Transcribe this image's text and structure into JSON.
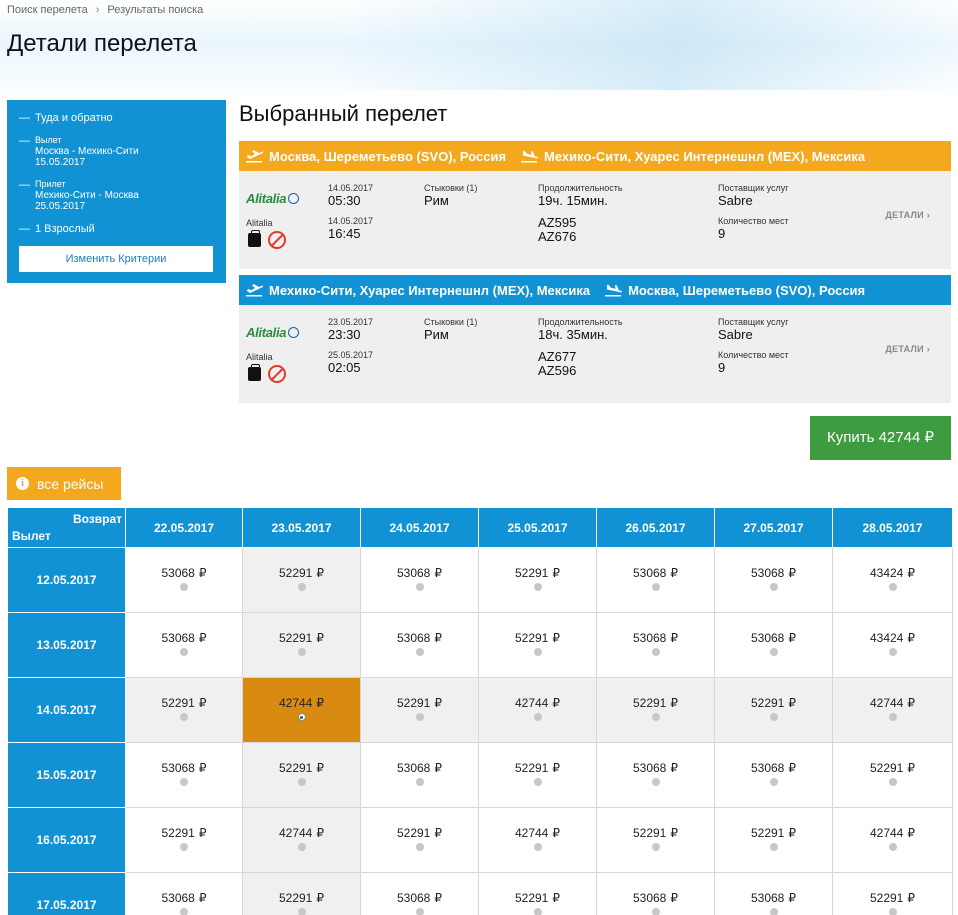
{
  "breadcrumb": {
    "item1": "Поиск перелета",
    "sep": "›",
    "item2": "Результаты поиска"
  },
  "page_title": "Детали перелета",
  "sidebar": {
    "trip_type": "Туда и обратно",
    "depart_label": "Вылет",
    "depart_route": "Москва - Мехико-Сити",
    "depart_date": "15.05.2017",
    "arrive_label": "Прилет",
    "arrive_route": "Мехико-Сити - Москва",
    "arrive_date": "25.05.2017",
    "passengers": "1 Взрослый",
    "change_button": "Изменить Критерии"
  },
  "selected_title": "Выбранный перелет",
  "flights": [
    {
      "head_color": "#f4a81d",
      "from": "Москва, Шереметьево (SVO), Россия",
      "to": "Мехико-Сити, Хуарес Интернешнл (MEX), Мексика",
      "logo": "Alitalia",
      "airline": "Alitalia",
      "dep_date": "14.05.2017",
      "dep_time": "05:30",
      "arr_date": "14.05.2017",
      "arr_time": "16:45",
      "stops_label": "Стыковки (1)",
      "stops_city": "Рим",
      "duration_label": "Продолжительность",
      "duration": "19ч. 15мин.",
      "flight1": "AZ595",
      "flight2": "AZ676",
      "provider_label": "Поставщик услуг",
      "provider": "Sabre",
      "seats_label": "Количество мест",
      "seats": "9",
      "details": "ДЕТАЛИ ›"
    },
    {
      "head_color": "#1192d4",
      "from": "Мехико-Сити, Хуарес Интернешнл (MEX), Мексика",
      "to": "Москва, Шереметьево (SVO), Россия",
      "logo": "Alitalia",
      "airline": "Alitalia",
      "dep_date": "23.05.2017",
      "dep_time": "23:30",
      "arr_date": "25.05.2017",
      "arr_time": "02:05",
      "stops_label": "Стыковки (1)",
      "stops_city": "Рим",
      "duration_label": "Продолжительность",
      "duration": "18ч. 35мин.",
      "flight1": "AZ677",
      "flight2": "AZ596",
      "provider_label": "Поставщик услуг",
      "provider": "Sabre",
      "seats_label": "Количество мест",
      "seats": "9",
      "details": "ДЕТАЛИ ›"
    }
  ],
  "buy_button": "Купить 42744 ₽",
  "all_flights_button": "все рейсы",
  "matrix": {
    "return_label": "Возврат",
    "depart_label": "Вылет",
    "currency": "₽",
    "return_dates": [
      "22.05.2017",
      "23.05.2017",
      "24.05.2017",
      "25.05.2017",
      "26.05.2017",
      "27.05.2017",
      "28.05.2017"
    ],
    "rows": [
      {
        "date": "12.05.2017",
        "prices": [
          "53068",
          "52291",
          "53068",
          "52291",
          "53068",
          "53068",
          "43424"
        ]
      },
      {
        "date": "13.05.2017",
        "prices": [
          "53068",
          "52291",
          "53068",
          "52291",
          "53068",
          "53068",
          "43424"
        ]
      },
      {
        "date": "14.05.2017",
        "prices": [
          "52291",
          "42744",
          "52291",
          "42744",
          "52291",
          "52291",
          "42744"
        ]
      },
      {
        "date": "15.05.2017",
        "prices": [
          "53068",
          "52291",
          "53068",
          "52291",
          "53068",
          "53068",
          "52291"
        ]
      },
      {
        "date": "16.05.2017",
        "prices": [
          "52291",
          "42744",
          "52291",
          "42744",
          "52291",
          "52291",
          "42744"
        ]
      },
      {
        "date": "17.05.2017",
        "prices": [
          "53068",
          "52291",
          "53068",
          "52291",
          "53068",
          "53068",
          "52291"
        ]
      }
    ],
    "selected": {
      "row": 2,
      "col": 1
    },
    "colors": {
      "selected": "#d98a10",
      "highlight": "#f0f0f0",
      "header": "#1192d4"
    }
  }
}
